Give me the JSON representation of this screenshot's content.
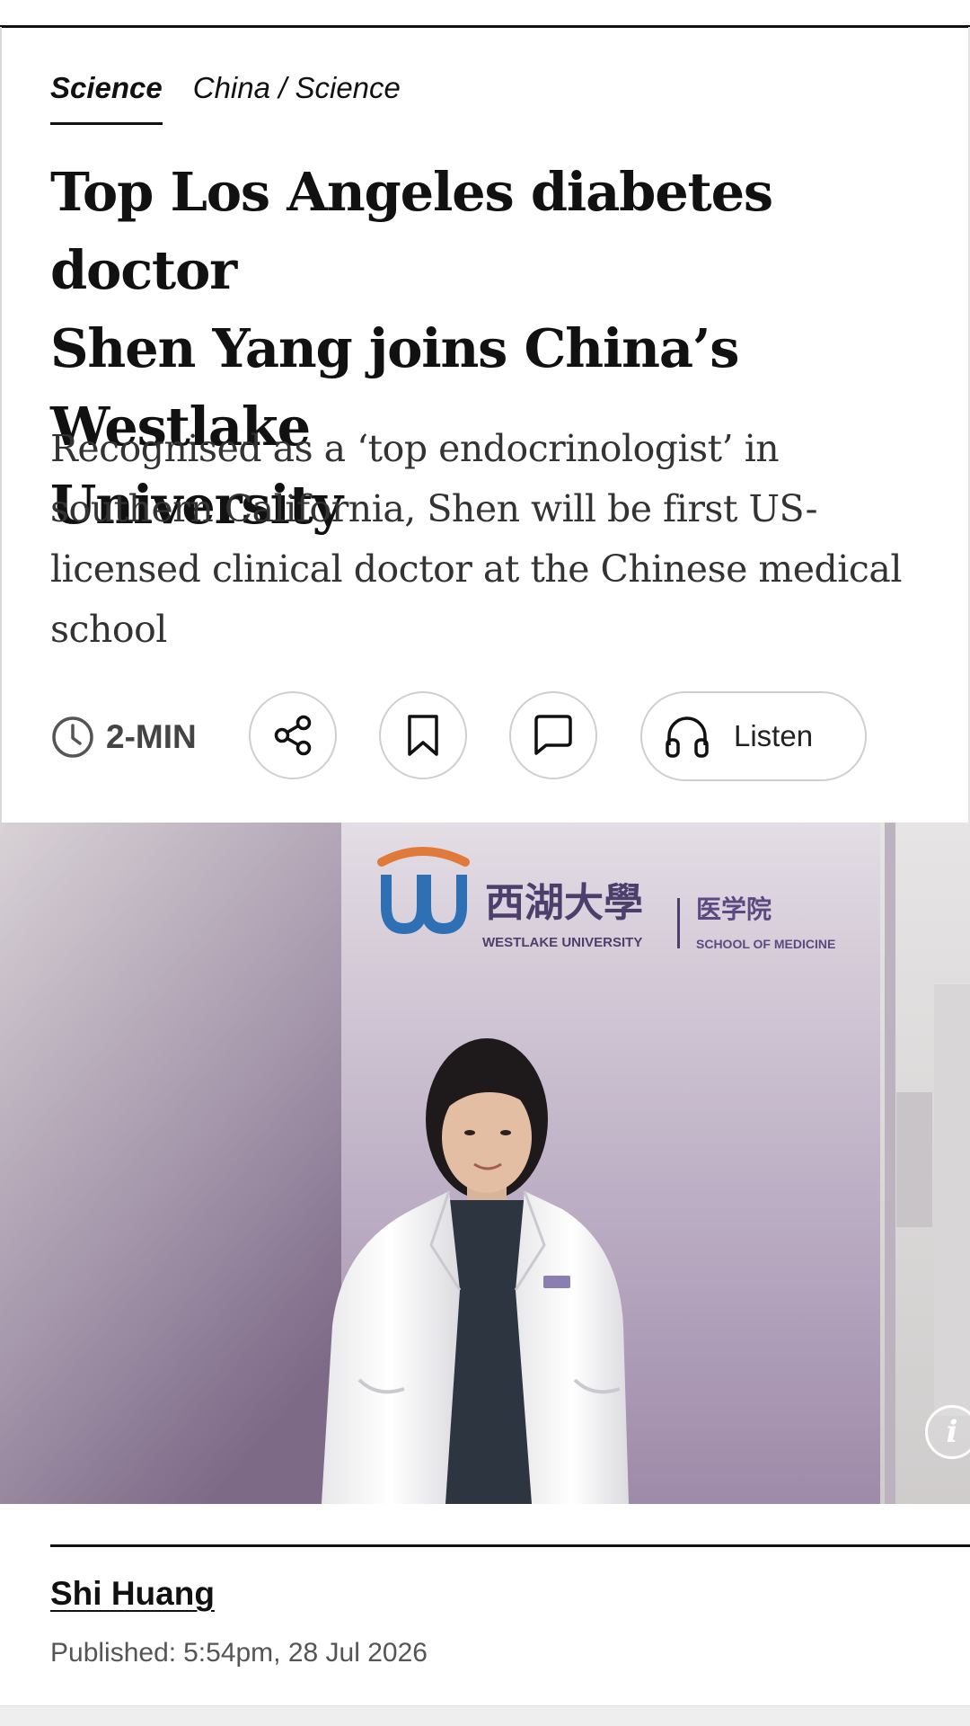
{
  "breadcrumb": {
    "section": "Science",
    "path": "China / Science"
  },
  "article": {
    "headline_lines": [
      "Top Los Angeles diabetes doctor",
      "Shen Yang joins China’s Westlake",
      "University"
    ],
    "summary_lines": [
      "Recognised as a ‘top endocrinologist’ in",
      "southern California, Shen will be first US-",
      "licensed clinical doctor at the Chinese medical",
      "school"
    ]
  },
  "toolbar": {
    "read_time": "2-MIN",
    "listen_label": "Listen",
    "icons": {
      "clock": "clock-icon",
      "share": "share-icon",
      "bookmark": "bookmark-icon",
      "comment": "comment-icon",
      "listen": "headphones-icon"
    }
  },
  "hero": {
    "sign_chinese": "西湖大學",
    "sign_english": "WESTLAKE UNIVERSITY",
    "sign_dept_chinese": "医学院",
    "sign_dept_english": "SCHOOL OF MEDICINE",
    "info_glyph": "i"
  },
  "author": {
    "name": "Shi Huang",
    "published_label": "Published:",
    "published_time": "5:54pm, 28 Jul 2026"
  },
  "colors": {
    "text": "#111111",
    "summary_text": "#333333",
    "muted": "#555555",
    "button_border": "#cfcfcf",
    "logo_blue": "#2f6fb3",
    "logo_orange": "#e07a3a",
    "sign_purple": "#5b4a82"
  }
}
